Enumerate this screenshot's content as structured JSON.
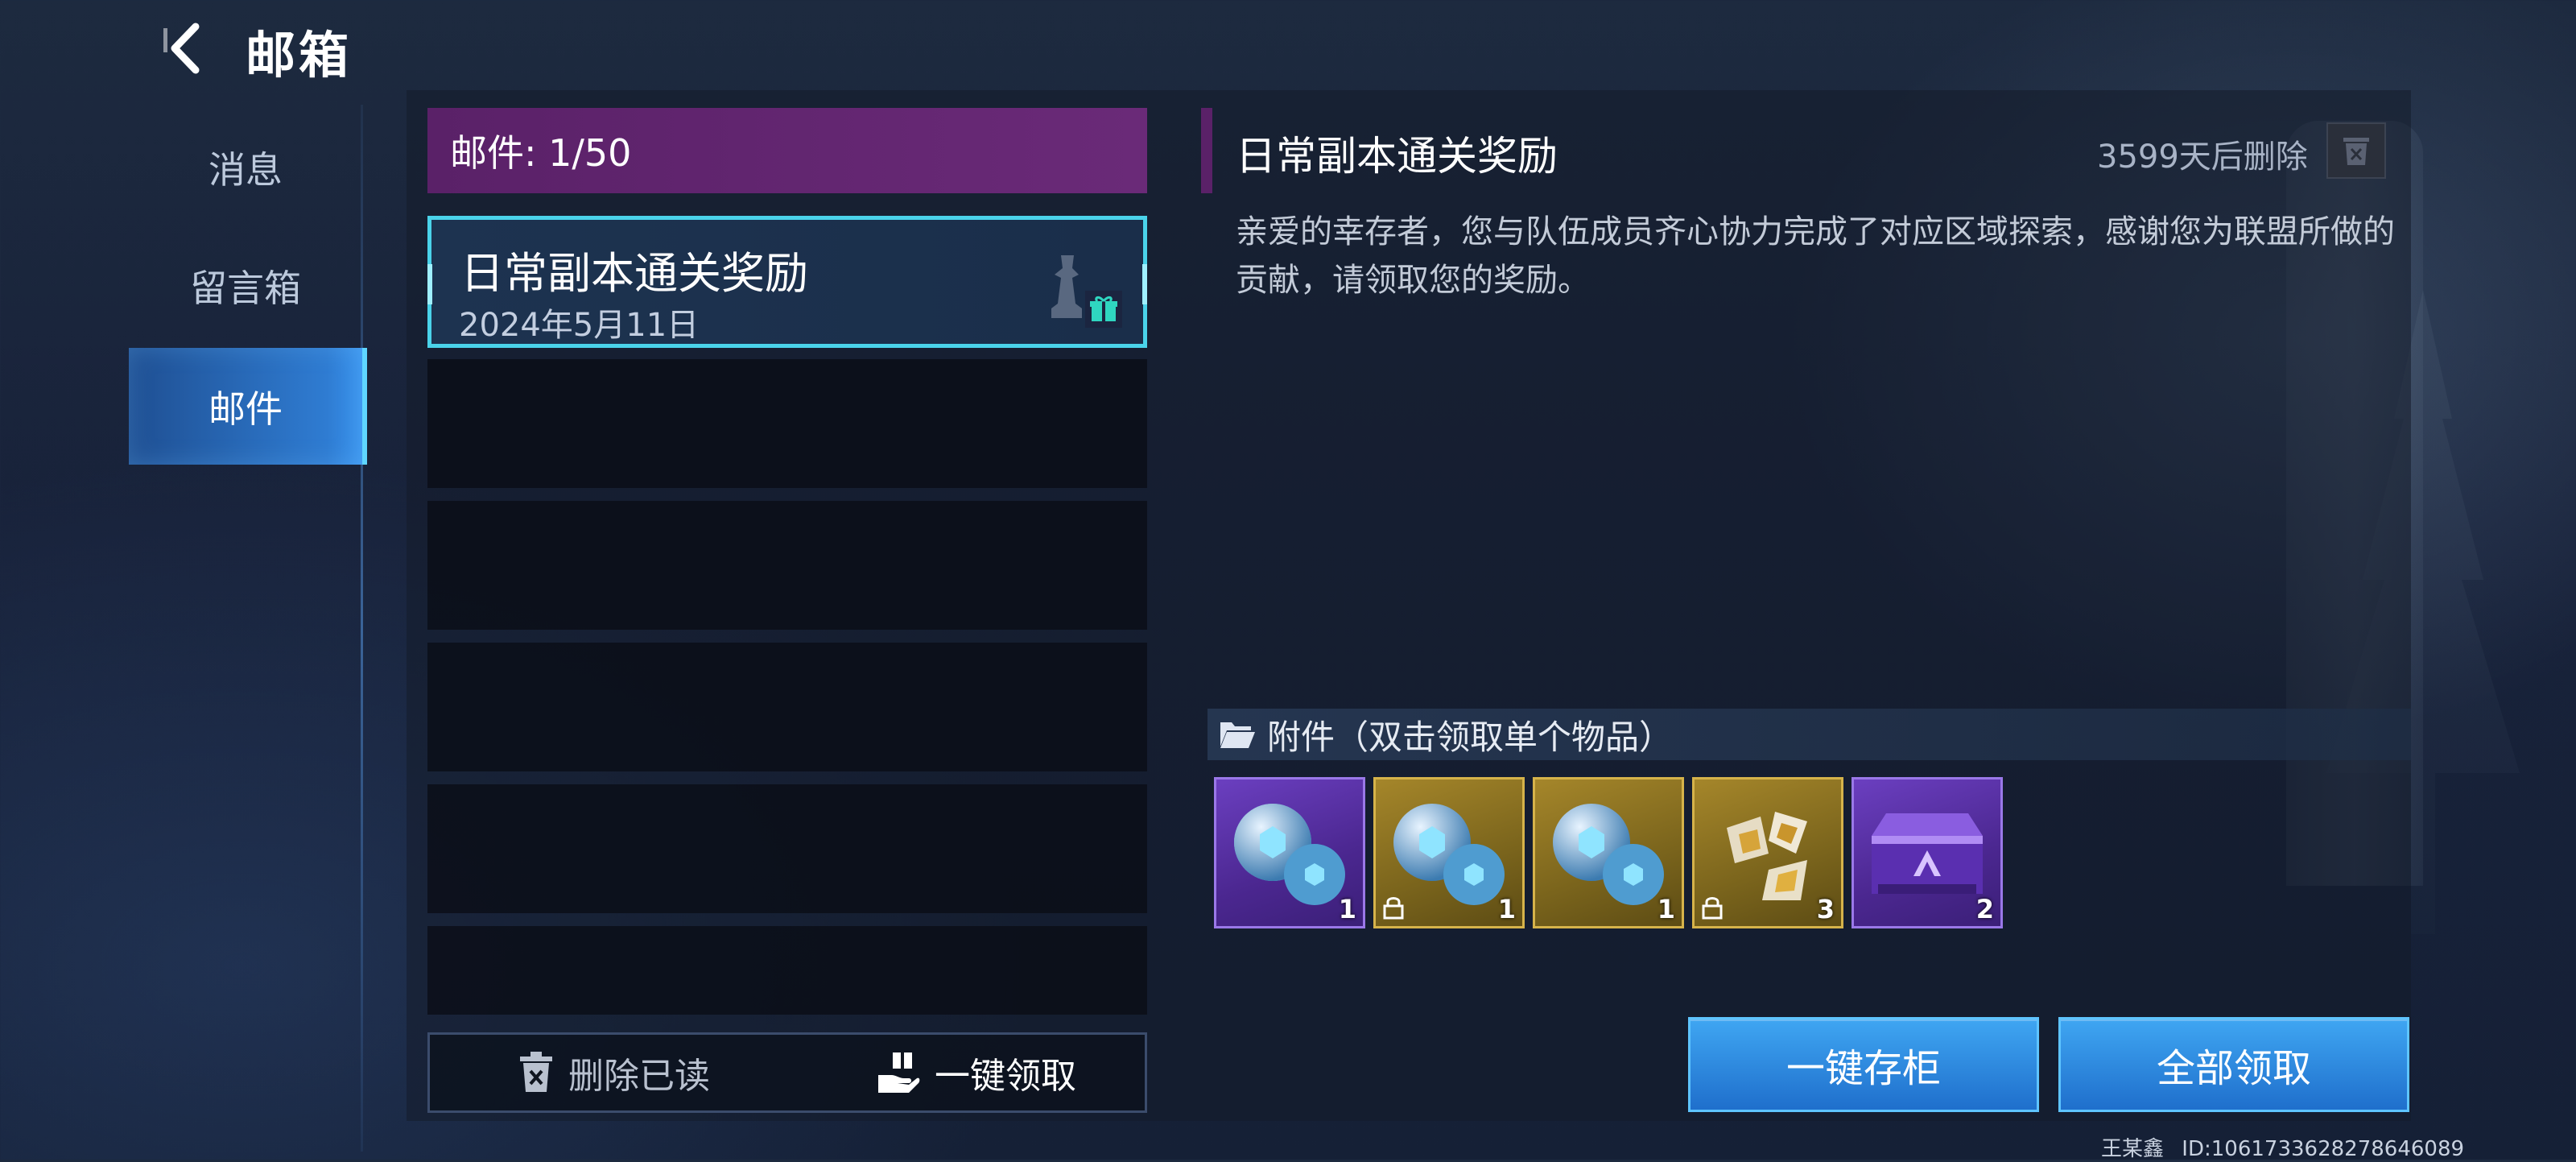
{
  "header": {
    "title": "邮箱"
  },
  "nav": {
    "items": [
      {
        "label": "消息"
      },
      {
        "label": "留言箱"
      },
      {
        "label": "邮件"
      }
    ],
    "active_index": 2
  },
  "mail_list": {
    "count_label": "邮件: 1/50",
    "mails": [
      {
        "title": "日常副本通关奖励",
        "date": "2024年5月11日"
      }
    ],
    "delete_read_label": "删除已读",
    "claim_one_key_label": "一键领取"
  },
  "detail": {
    "title": "日常副本通关奖励",
    "expire": "3599天后删除",
    "body": "亲爱的幸存者，您与队伍成员齐心协力完成了对应区域探索，感谢您为联盟所做的贡献，请领取您的奖励。",
    "attachments_label": "附件（双击领取单个物品）",
    "items": [
      {
        "rarity": "purple",
        "icon": "orb-cluster-icon",
        "qty": "1",
        "locked": false
      },
      {
        "rarity": "gold",
        "icon": "orb-cluster-icon",
        "qty": "1",
        "locked": true
      },
      {
        "rarity": "gold",
        "icon": "orb-cluster-icon",
        "qty": "1",
        "locked": false
      },
      {
        "rarity": "gold",
        "icon": "crystal-shards-icon",
        "qty": "3",
        "locked": true
      },
      {
        "rarity": "purple",
        "icon": "treasure-chest-icon",
        "qty": "2",
        "locked": false
      }
    ]
  },
  "actions": {
    "store_all_label": "一键存柜",
    "claim_all_label": "全部领取"
  },
  "footer": {
    "player": "王某鑫",
    "id_text": "ID:1061733628278646089"
  },
  "colors": {
    "accent_cyan": "#4ad3ea",
    "mail_header_purple": "#5a2168",
    "button_blue": "#2f86e0",
    "rarity_purple": "#5a34a8",
    "rarity_gold": "#8f7422"
  }
}
